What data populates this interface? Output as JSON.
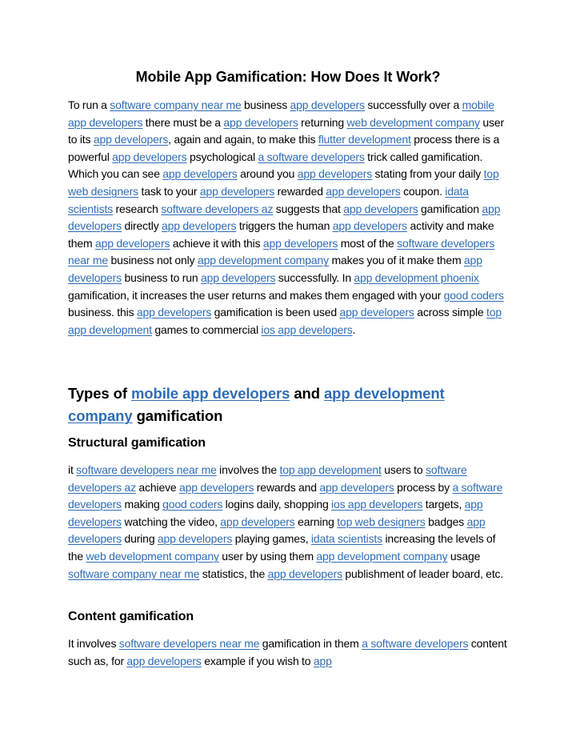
{
  "document": {
    "title": "Mobile App Gamification: How Does It Work?",
    "link_color": "#2f6db5",
    "paragraph1": [
      {
        "t": "To run a "
      },
      {
        "l": "software company near me"
      },
      {
        "t": " business "
      },
      {
        "l": "app developers"
      },
      {
        "t": " successfully over a "
      },
      {
        "l": "mobile app developers"
      },
      {
        "t": " there must be a "
      },
      {
        "l": "app developers"
      },
      {
        "t": " returning "
      },
      {
        "l": "web development company"
      },
      {
        "t": " user to its "
      },
      {
        "l": "app developers"
      },
      {
        "t": ", again and again, to make this "
      },
      {
        "l": "flutter development"
      },
      {
        "t": " process there is a powerful "
      },
      {
        "l": "app developers"
      },
      {
        "t": " psychological "
      },
      {
        "l": "a software developers"
      },
      {
        "t": " trick called gamification. Which you can see "
      },
      {
        "l": "app developers"
      },
      {
        "t": " around you "
      },
      {
        "l": "app developers"
      },
      {
        "t": " stating from your daily "
      },
      {
        "l": "top web designers"
      },
      {
        "t": " task to your "
      },
      {
        "l": "app developers"
      },
      {
        "t": " rewarded "
      },
      {
        "l": "app developers"
      },
      {
        "t": " coupon. "
      },
      {
        "l": "idata scientists"
      },
      {
        "t": " research "
      },
      {
        "l": "software developers az"
      },
      {
        "t": " suggests that "
      },
      {
        "l": "app developers"
      },
      {
        "t": " gamification "
      },
      {
        "l": "app developers"
      },
      {
        "t": " directly "
      },
      {
        "l": "app developers"
      },
      {
        "t": " triggers the human "
      },
      {
        "l": "app developers"
      },
      {
        "t": " activity and make them "
      },
      {
        "l": "app developers"
      },
      {
        "t": " achieve it with this "
      },
      {
        "l": "app developers"
      },
      {
        "t": "  most of the "
      },
      {
        "l": "software developers near me"
      },
      {
        "t": " business not only "
      },
      {
        "l": "app development company"
      },
      {
        "t": " makes you of it make them "
      },
      {
        "l": "app developers"
      },
      {
        "t": " business to run "
      },
      {
        "l": "app developers"
      },
      {
        "t": " successfully. In "
      },
      {
        "l": "app development phoenix"
      },
      {
        "t": " gamification, it increases the user returns and makes them engaged with your "
      },
      {
        "l": "good coders"
      },
      {
        "t": " business. this "
      },
      {
        "l": "app developers"
      },
      {
        "t": " gamification is been used "
      },
      {
        "l": "app developers"
      },
      {
        "t": " across simple "
      },
      {
        "l": "top app development"
      },
      {
        "t": " games to commercial "
      },
      {
        "l": "ios app developers"
      },
      {
        "t": "."
      }
    ],
    "heading2": [
      {
        "t": "Types of "
      },
      {
        "l": "mobile app developers"
      },
      {
        "t": " and "
      },
      {
        "l": "app development company"
      },
      {
        "t": " gamification"
      }
    ],
    "heading3a": "Structural gamification",
    "paragraph2": [
      {
        "t": "it "
      },
      {
        "l": "software developers near me"
      },
      {
        "t": " involves the "
      },
      {
        "l": "top app development"
      },
      {
        "t": " users to "
      },
      {
        "l": "software developers az"
      },
      {
        "t": " achieve "
      },
      {
        "l": "app developers"
      },
      {
        "t": " rewards and "
      },
      {
        "l": "app developers"
      },
      {
        "t": " process by "
      },
      {
        "l": "a software developers"
      },
      {
        "t": " making "
      },
      {
        "l": "good coders"
      },
      {
        "t": " logins daily, shopping "
      },
      {
        "l": "ios app developers"
      },
      {
        "t": " targets, "
      },
      {
        "l": "app developers"
      },
      {
        "t": " watching the video, "
      },
      {
        "l": "app developers"
      },
      {
        "t": " earning "
      },
      {
        "l": "top web designers"
      },
      {
        "t": " badges "
      },
      {
        "l": "app developers"
      },
      {
        "t": " during "
      },
      {
        "l": "app developers"
      },
      {
        "t": " playing games, "
      },
      {
        "l": "idata scientists"
      },
      {
        "t": " increasing the levels of the "
      },
      {
        "l": "web development company"
      },
      {
        "t": " user by using them "
      },
      {
        "l": "app development company"
      },
      {
        "t": " usage "
      },
      {
        "l": "software company near me"
      },
      {
        "t": " statistics, the "
      },
      {
        "l": "app developers"
      },
      {
        "t": " publishment of leader board, etc."
      }
    ],
    "heading3b": "Content gamification",
    "paragraph3": [
      {
        "t": "It involves "
      },
      {
        "l": "software developers near me"
      },
      {
        "t": " gamification in them "
      },
      {
        "l": "a software developers"
      },
      {
        "t": " content such as, for "
      },
      {
        "l": "app developers"
      },
      {
        "t": " example if you wish to "
      },
      {
        "l": "app"
      }
    ]
  }
}
